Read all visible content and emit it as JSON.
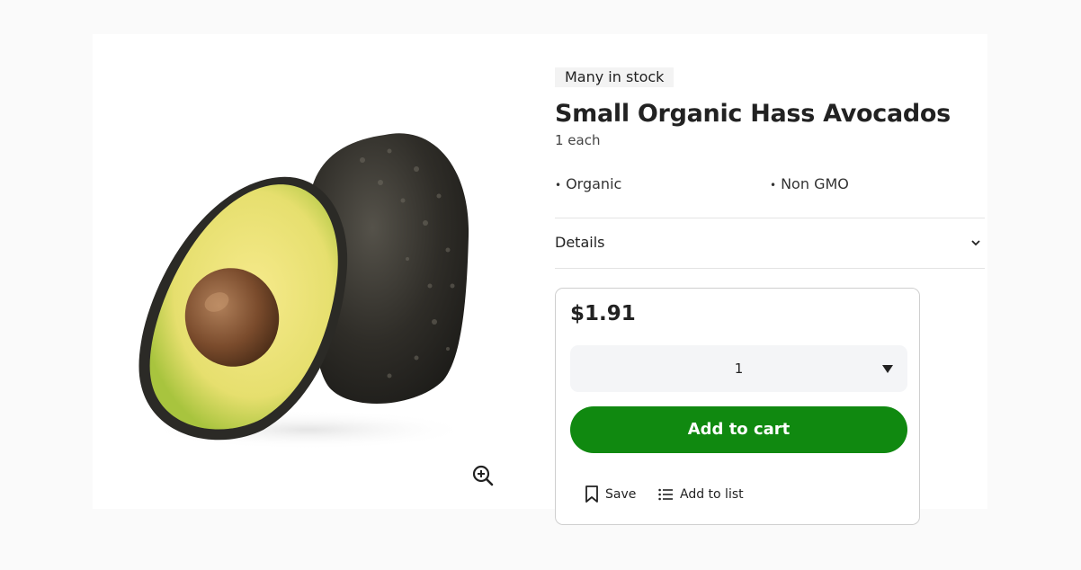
{
  "product": {
    "stock_badge": "Many in stock",
    "title": "Small Organic Hass Avocados",
    "size": "1 each",
    "attributes": [
      "Organic",
      "Non GMO"
    ],
    "image_alt": "avocado-product-image"
  },
  "details": {
    "label": "Details",
    "icon": "chevron-down-icon"
  },
  "purchase": {
    "price": "$1.91",
    "quantity": "1",
    "add_to_cart_label": "Add to cart",
    "save_label": "Save",
    "add_to_list_label": "Add to list",
    "accent_color": "#108910"
  },
  "icons": {
    "zoom": "zoom-in-icon",
    "save": "bookmark-icon",
    "list": "list-icon",
    "quantity_caret": "caret-down-icon"
  }
}
